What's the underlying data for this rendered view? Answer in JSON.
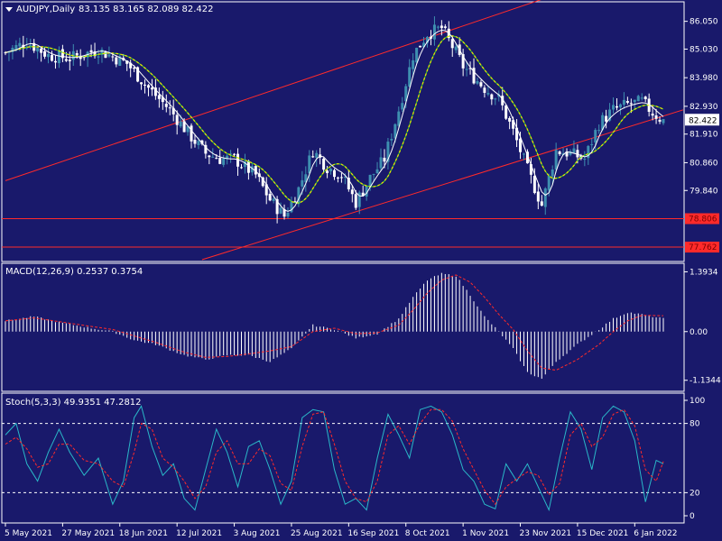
{
  "header": {
    "symbol": "AUDJPY,Daily",
    "ohlc": "83.135 83.165 82.089 82.422",
    "menu_arrow": "triangle-down-icon"
  },
  "colors": {
    "background": "#19196b",
    "grid": "#ffffff",
    "bull": "#3e8fb0",
    "bear": "#ffffff",
    "ma_green": "#2ddc2d",
    "ma_yellow": "#e8e800",
    "ma_white": "#ffffff",
    "channel": "#ff2a2a",
    "macd_signal": "#ff2a2a",
    "macd_hist": "#ffffff",
    "stoch_main": "#2ab8c8",
    "stoch_signal": "#ff2a2a",
    "price_tag_bg": "#ff2a2a",
    "current_tag_bg": "#ffffff"
  },
  "chart_data": [
    {
      "type": "candlestick",
      "title": "AUDJPY,Daily",
      "ylim": [
        77.3,
        86.7
      ],
      "yticks": [
        "86.050",
        "85.030",
        "83.980",
        "82.930",
        "81.910",
        "80.860",
        "79.840"
      ],
      "yticks_values": [
        86.05,
        85.03,
        83.98,
        82.93,
        81.91,
        80.86,
        79.84
      ],
      "current_price": "82.422",
      "levels": [
        {
          "label": "78.806",
          "value": 78.806
        },
        {
          "label": "77.762",
          "value": 77.762
        }
      ],
      "xticks": [
        "5 May 2021",
        "27 May 2021",
        "18 Jun 2021",
        "12 Jul 2021",
        "3 Aug 2021",
        "25 Aug 2021",
        "16 Sep 2021",
        "8 Oct 2021",
        "1 Nov 2021",
        "23 Nov 2021",
        "15 Dec 2021",
        "6 Jan 2022"
      ],
      "xticks_index": [
        0,
        16,
        32,
        48,
        64,
        80,
        96,
        112,
        128,
        144,
        160,
        176
      ],
      "bars": 185,
      "close_path": [
        [
          0,
          84.9
        ],
        [
          6,
          85.3
        ],
        [
          12,
          84.8
        ],
        [
          18,
          84.7
        ],
        [
          26,
          85.0
        ],
        [
          34,
          84.5
        ],
        [
          40,
          83.6
        ],
        [
          46,
          82.8
        ],
        [
          52,
          81.8
        ],
        [
          56,
          81.2
        ],
        [
          60,
          81.0
        ],
        [
          64,
          81.0
        ],
        [
          70,
          80.4
        ],
        [
          74,
          79.5
        ],
        [
          78,
          78.9
        ],
        [
          82,
          79.9
        ],
        [
          86,
          81.3
        ],
        [
          90,
          80.7
        ],
        [
          94,
          80.4
        ],
        [
          98,
          79.4
        ],
        [
          102,
          80.3
        ],
        [
          106,
          81.0
        ],
        [
          110,
          82.8
        ],
        [
          114,
          84.8
        ],
        [
          118,
          85.6
        ],
        [
          122,
          85.8
        ],
        [
          126,
          84.9
        ],
        [
          128,
          84.4
        ],
        [
          134,
          83.6
        ],
        [
          138,
          83.2
        ],
        [
          142,
          82.0
        ],
        [
          146,
          80.6
        ],
        [
          150,
          79.3
        ],
        [
          154,
          81.3
        ],
        [
          158,
          81.2
        ],
        [
          162,
          81.0
        ],
        [
          166,
          82.3
        ],
        [
          170,
          82.8
        ],
        [
          174,
          83.0
        ],
        [
          178,
          83.1
        ],
        [
          181,
          82.7
        ],
        [
          184,
          82.4
        ]
      ],
      "channel_lines": [
        {
          "from": [
            0,
            80.2
          ],
          "to": [
            151,
            86.9
          ]
        },
        {
          "from": [
            55,
            77.3
          ],
          "to": [
            184,
            82.8
          ]
        }
      ],
      "series": [
        {
          "name": "",
          "role": "slow_ma",
          "color": "green_yellow"
        },
        {
          "name": "",
          "role": "fast_ma",
          "color": "white"
        }
      ]
    },
    {
      "type": "bar",
      "title": "MACD(12,26,9) 0.2537 0.3754",
      "ylim": [
        -1.35,
        1.55
      ],
      "yticks": [
        "1.3934",
        "0.00",
        "-1.1344"
      ],
      "yticks_values": [
        1.3934,
        0.0,
        -1.1344
      ],
      "histogram_path": [
        [
          0,
          0.25
        ],
        [
          8,
          0.35
        ],
        [
          16,
          0.2
        ],
        [
          24,
          0.08
        ],
        [
          30,
          0.0
        ],
        [
          36,
          -0.2
        ],
        [
          42,
          -0.3
        ],
        [
          50,
          -0.55
        ],
        [
          56,
          -0.65
        ],
        [
          62,
          -0.55
        ],
        [
          68,
          -0.55
        ],
        [
          74,
          -0.7
        ],
        [
          80,
          -0.4
        ],
        [
          86,
          0.15
        ],
        [
          92,
          0.05
        ],
        [
          98,
          -0.15
        ],
        [
          104,
          -0.05
        ],
        [
          110,
          0.3
        ],
        [
          114,
          0.8
        ],
        [
          118,
          1.2
        ],
        [
          122,
          1.35
        ],
        [
          126,
          1.3
        ],
        [
          130,
          0.85
        ],
        [
          134,
          0.35
        ],
        [
          138,
          0.0
        ],
        [
          142,
          -0.4
        ],
        [
          146,
          -0.95
        ],
        [
          150,
          -1.1
        ],
        [
          154,
          -0.7
        ],
        [
          160,
          -0.3
        ],
        [
          166,
          0.05
        ],
        [
          170,
          0.3
        ],
        [
          174,
          0.45
        ],
        [
          178,
          0.4
        ],
        [
          184,
          0.3
        ]
      ],
      "signal_path": [
        [
          0,
          0.25
        ],
        [
          8,
          0.32
        ],
        [
          16,
          0.22
        ],
        [
          24,
          0.12
        ],
        [
          30,
          0.05
        ],
        [
          36,
          -0.1
        ],
        [
          42,
          -0.25
        ],
        [
          50,
          -0.48
        ],
        [
          56,
          -0.6
        ],
        [
          62,
          -0.58
        ],
        [
          68,
          -0.52
        ],
        [
          74,
          -0.45
        ],
        [
          80,
          -0.35
        ],
        [
          86,
          0.0
        ],
        [
          92,
          0.08
        ],
        [
          98,
          -0.05
        ],
        [
          104,
          -0.03
        ],
        [
          110,
          0.15
        ],
        [
          114,
          0.5
        ],
        [
          118,
          0.9
        ],
        [
          122,
          1.2
        ],
        [
          126,
          1.32
        ],
        [
          130,
          1.15
        ],
        [
          134,
          0.8
        ],
        [
          138,
          0.4
        ],
        [
          142,
          0.05
        ],
        [
          146,
          -0.45
        ],
        [
          150,
          -0.85
        ],
        [
          154,
          -0.9
        ],
        [
          160,
          -0.65
        ],
        [
          166,
          -0.3
        ],
        [
          170,
          0.0
        ],
        [
          174,
          0.25
        ],
        [
          178,
          0.38
        ],
        [
          184,
          0.37
        ]
      ]
    },
    {
      "type": "line",
      "title": "Stoch(5,3,3) 49.9351 47.2812",
      "ylim": [
        0,
        100
      ],
      "yticks": [
        "100",
        "80",
        "20",
        "0"
      ],
      "yticks_values": [
        100,
        80,
        20,
        0
      ],
      "levels": [
        80,
        20
      ],
      "main_path": [
        [
          0,
          70
        ],
        [
          3,
          80
        ],
        [
          6,
          45
        ],
        [
          9,
          30
        ],
        [
          12,
          55
        ],
        [
          15,
          75
        ],
        [
          18,
          55
        ],
        [
          22,
          35
        ],
        [
          26,
          50
        ],
        [
          30,
          10
        ],
        [
          33,
          30
        ],
        [
          36,
          85
        ],
        [
          38,
          95
        ],
        [
          41,
          60
        ],
        [
          44,
          35
        ],
        [
          47,
          45
        ],
        [
          50,
          15
        ],
        [
          53,
          5
        ],
        [
          56,
          40
        ],
        [
          59,
          75
        ],
        [
          62,
          55
        ],
        [
          65,
          25
        ],
        [
          68,
          60
        ],
        [
          71,
          65
        ],
        [
          74,
          40
        ],
        [
          77,
          10
        ],
        [
          80,
          30
        ],
        [
          83,
          85
        ],
        [
          86,
          92
        ],
        [
          89,
          90
        ],
        [
          92,
          40
        ],
        [
          95,
          10
        ],
        [
          98,
          15
        ],
        [
          101,
          5
        ],
        [
          104,
          50
        ],
        [
          107,
          88
        ],
        [
          110,
          70
        ],
        [
          113,
          50
        ],
        [
          116,
          92
        ],
        [
          119,
          95
        ],
        [
          122,
          90
        ],
        [
          125,
          70
        ],
        [
          128,
          40
        ],
        [
          131,
          30
        ],
        [
          134,
          10
        ],
        [
          137,
          6
        ],
        [
          140,
          45
        ],
        [
          143,
          30
        ],
        [
          146,
          45
        ],
        [
          149,
          25
        ],
        [
          152,
          5
        ],
        [
          155,
          50
        ],
        [
          158,
          90
        ],
        [
          161,
          75
        ],
        [
          164,
          40
        ],
        [
          167,
          85
        ],
        [
          170,
          95
        ],
        [
          173,
          90
        ],
        [
          176,
          65
        ],
        [
          179,
          12
        ],
        [
          182,
          48
        ],
        [
          184,
          45
        ]
      ],
      "signal_path": [
        [
          0,
          62
        ],
        [
          3,
          68
        ],
        [
          6,
          58
        ],
        [
          9,
          42
        ],
        [
          12,
          45
        ],
        [
          15,
          62
        ],
        [
          18,
          62
        ],
        [
          22,
          48
        ],
        [
          26,
          45
        ],
        [
          30,
          30
        ],
        [
          33,
          25
        ],
        [
          36,
          55
        ],
        [
          38,
          80
        ],
        [
          41,
          75
        ],
        [
          44,
          50
        ],
        [
          47,
          42
        ],
        [
          50,
          30
        ],
        [
          53,
          15
        ],
        [
          56,
          25
        ],
        [
          59,
          55
        ],
        [
          62,
          65
        ],
        [
          65,
          45
        ],
        [
          68,
          45
        ],
        [
          71,
          58
        ],
        [
          74,
          52
        ],
        [
          77,
          28
        ],
        [
          80,
          22
        ],
        [
          83,
          60
        ],
        [
          86,
          88
        ],
        [
          89,
          90
        ],
        [
          92,
          62
        ],
        [
          95,
          30
        ],
        [
          98,
          15
        ],
        [
          101,
          12
        ],
        [
          104,
          30
        ],
        [
          107,
          70
        ],
        [
          110,
          78
        ],
        [
          113,
          62
        ],
        [
          116,
          80
        ],
        [
          119,
          92
        ],
        [
          122,
          92
        ],
        [
          125,
          82
        ],
        [
          128,
          58
        ],
        [
          131,
          40
        ],
        [
          134,
          22
        ],
        [
          137,
          10
        ],
        [
          140,
          25
        ],
        [
          143,
          32
        ],
        [
          146,
          38
        ],
        [
          149,
          35
        ],
        [
          152,
          18
        ],
        [
          155,
          28
        ],
        [
          158,
          70
        ],
        [
          161,
          80
        ],
        [
          164,
          60
        ],
        [
          167,
          68
        ],
        [
          170,
          88
        ],
        [
          173,
          92
        ],
        [
          176,
          78
        ],
        [
          179,
          40
        ],
        [
          182,
          30
        ],
        [
          184,
          47
        ]
      ]
    }
  ]
}
